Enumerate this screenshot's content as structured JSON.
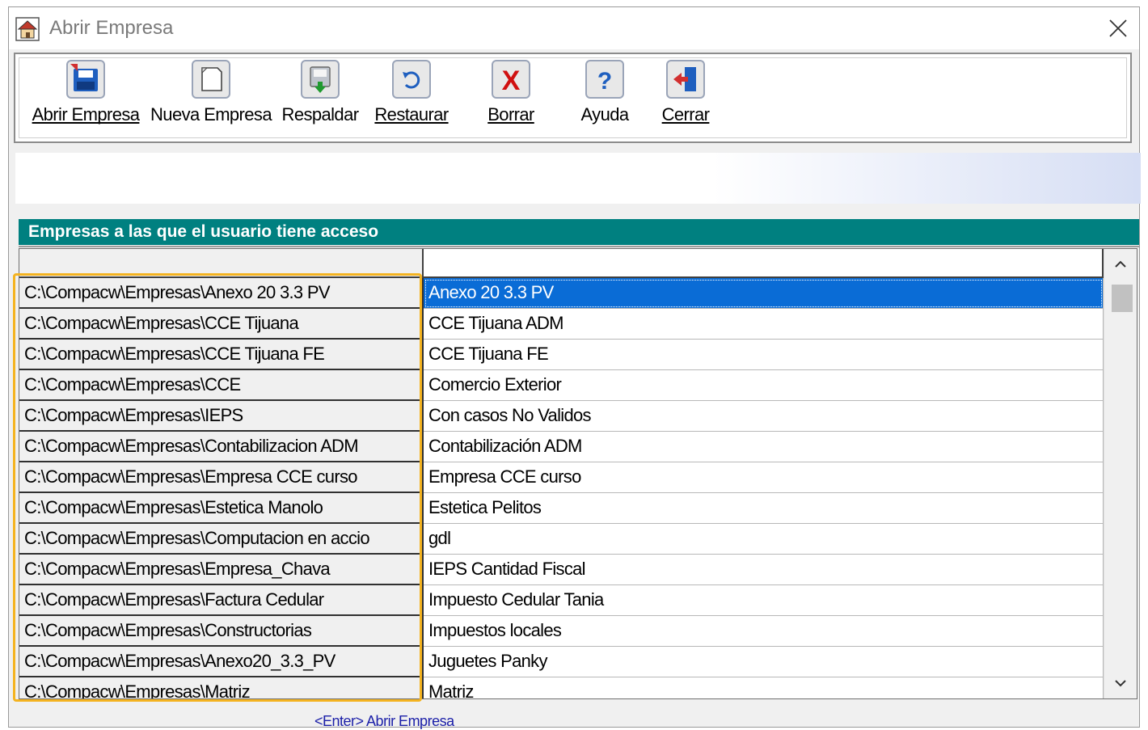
{
  "window": {
    "title": "Abrir Empresa"
  },
  "toolbar": {
    "buttons": [
      {
        "label": "Abrir Empresa",
        "icon": "open-company-icon"
      },
      {
        "label": "Nueva Empresa",
        "icon": "new-company-icon"
      },
      {
        "label": "Respaldar",
        "icon": "backup-icon"
      },
      {
        "label": "Restaurar",
        "icon": "restore-icon"
      },
      {
        "label": "Borrar",
        "icon": "delete-icon"
      },
      {
        "label": "Ayuda",
        "icon": "help-icon"
      },
      {
        "label": "Cerrar",
        "icon": "close-door-icon"
      }
    ]
  },
  "section": {
    "header": "Empresas a las que el usuario tiene acceso"
  },
  "grid": {
    "columns": [
      "",
      ""
    ],
    "rows": [
      {
        "path": "C:\\Compacw\\Empresas\\Anexo 20 3.3 PV",
        "name": "Anexo 20 3.3 PV",
        "selected": true
      },
      {
        "path": "C:\\Compacw\\Empresas\\CCE Tijuana",
        "name": "CCE Tijuana ADM"
      },
      {
        "path": "C:\\Compacw\\Empresas\\CCE Tijuana FE",
        "name": "CCE Tijuana FE"
      },
      {
        "path": "C:\\Compacw\\Empresas\\CCE",
        "name": "Comercio Exterior"
      },
      {
        "path": "C:\\Compacw\\Empresas\\IEPS",
        "name": "Con casos No Validos"
      },
      {
        "path": "C:\\Compacw\\Empresas\\Contabilizacion ADM",
        "name": "Contabilización ADM"
      },
      {
        "path": "C:\\Compacw\\Empresas\\Empresa CCE curso",
        "name": "Empresa CCE curso"
      },
      {
        "path": "C:\\Compacw\\Empresas\\Estetica Manolo",
        "name": "Estetica Pelitos"
      },
      {
        "path": "C:\\Compacw\\Empresas\\Computacion en accio",
        "name": "gdl"
      },
      {
        "path": "C:\\Compacw\\Empresas\\Empresa_Chava",
        "name": "IEPS Cantidad Fiscal"
      },
      {
        "path": "C:\\Compacw\\Empresas\\Factura Cedular",
        "name": "Impuesto Cedular Tania"
      },
      {
        "path": "C:\\Compacw\\Empresas\\Constructorias",
        "name": "Impuestos locales"
      },
      {
        "path": "C:\\Compacw\\Empresas\\Anexo20_3.3_PV",
        "name": "Juguetes Panky"
      },
      {
        "path": "C:\\Compacw\\Empresas\\Matriz",
        "name": "Matriz"
      }
    ]
  },
  "footer": {
    "hint": "<Enter> Abrir Empresa"
  },
  "colors": {
    "header_teal": "#008080",
    "selection_blue": "#0a6cd6",
    "highlight_orange": "#f4b320"
  }
}
